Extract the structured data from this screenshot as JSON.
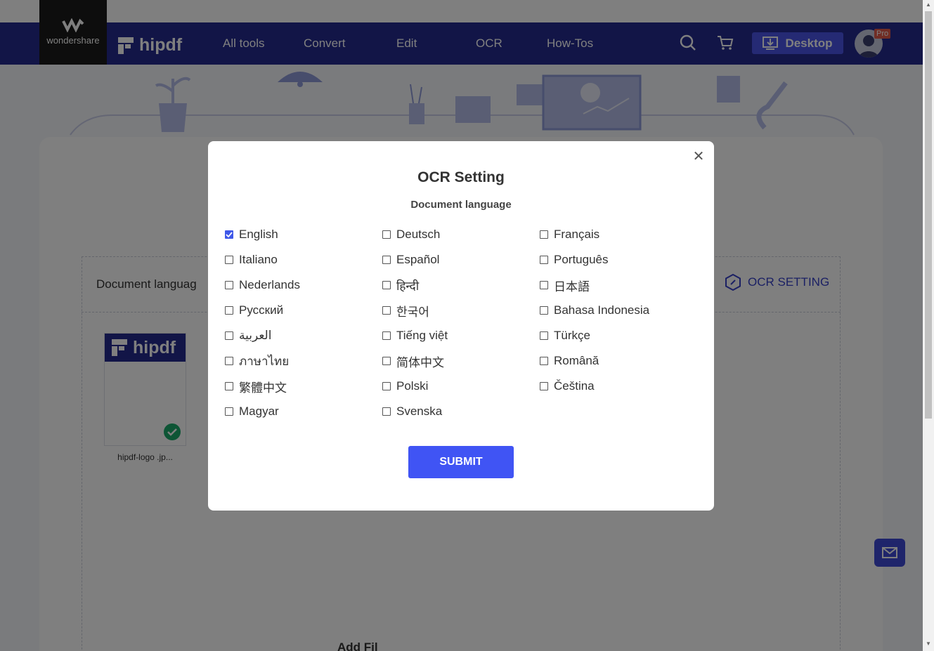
{
  "brand": {
    "wondershare_text": "wondershare",
    "hipdf_text": "hipdf",
    "pro_badge": "Pro"
  },
  "nav": {
    "items": [
      "All tools",
      "Convert",
      "Edit",
      "OCR",
      "How-Tos"
    ],
    "desktop_label": "Desktop"
  },
  "page": {
    "document_language_label": "Document languag",
    "ocr_setting_label": "OCR SETTING",
    "file_name": "hipdf-logo .jp...",
    "thumb_logo_text": "hipdf",
    "add_files_partial": "Add Fil"
  },
  "modal": {
    "title": "OCR Setting",
    "subtitle": "Document language",
    "submit_label": "SUBMIT",
    "languages": [
      {
        "label": "English",
        "checked": true
      },
      {
        "label": "Deutsch",
        "checked": false
      },
      {
        "label": "Français",
        "checked": false
      },
      {
        "label": "Italiano",
        "checked": false
      },
      {
        "label": "Español",
        "checked": false
      },
      {
        "label": "Português",
        "checked": false
      },
      {
        "label": "Nederlands",
        "checked": false
      },
      {
        "label": "हिन्दी",
        "checked": false
      },
      {
        "label": "日本語",
        "checked": false
      },
      {
        "label": "Русский",
        "checked": false
      },
      {
        "label": "한국어",
        "checked": false
      },
      {
        "label": "Bahasa Indonesia",
        "checked": false
      },
      {
        "label": "العربية",
        "checked": false
      },
      {
        "label": "Tiếng việt",
        "checked": false
      },
      {
        "label": "Türkçe",
        "checked": false
      },
      {
        "label": "ภาษาไทย",
        "checked": false
      },
      {
        "label": "简体中文",
        "checked": false
      },
      {
        "label": "Română",
        "checked": false
      },
      {
        "label": "繁體中文",
        "checked": false
      },
      {
        "label": "Polski",
        "checked": false
      },
      {
        "label": "Čeština",
        "checked": false
      },
      {
        "label": "Magyar",
        "checked": false
      },
      {
        "label": "Svenska",
        "checked": false
      }
    ]
  },
  "colors": {
    "navbar": "#252a8e",
    "accent": "#4054f4",
    "checked": "#3f58e8"
  },
  "icons": {
    "close": "close-icon",
    "search": "search-icon",
    "cart": "cart-icon",
    "download": "download-icon",
    "mail": "mail-icon",
    "check": "check-icon"
  }
}
